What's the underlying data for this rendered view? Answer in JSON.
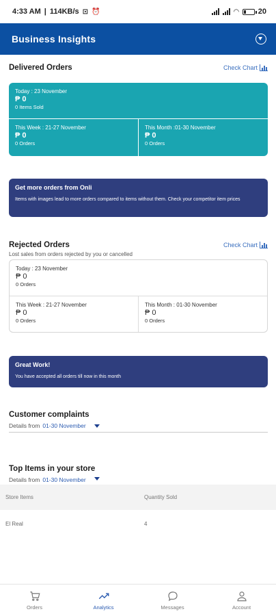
{
  "status_bar": {
    "time": "4:33 AM",
    "speed": "114KB/s",
    "battery": "20"
  },
  "app_bar": {
    "title": "Business Insights",
    "filter_icon": "filter-icon"
  },
  "delivered": {
    "title": "Delivered Orders",
    "check_chart": "Check Chart",
    "today": {
      "label": "Today : 23 November",
      "value": "₱ 0",
      "sub": "0 Items Sold"
    },
    "week": {
      "label": "This Week : 21-27 November",
      "value": "₱ 0",
      "sub": "0 Orders"
    },
    "month": {
      "label": "This Month :01-30 November",
      "value": "₱ 0",
      "sub": "0 Orders"
    }
  },
  "promo": {
    "title": "Get more orders from Onli",
    "body": "Items with images lead to more orders compared to items without them. Check your competitor item prices"
  },
  "rejected": {
    "title": "Rejected Orders",
    "check_chart": "Check Chart",
    "subtitle": "Lost sales from orders rejected by you or cancelled",
    "today": {
      "label": "Today : 23 November",
      "value": "₱ 0",
      "sub": "0 Orders"
    },
    "week": {
      "label": "This Week : 21-27 November",
      "value": "₱ 0",
      "sub": "0 Orders"
    },
    "month": {
      "label": "This Month : 01-30 November",
      "value": "₱ 0",
      "sub": "0 Orders"
    }
  },
  "great_work": {
    "title": "Great Work!",
    "body": "You have accepted all orders till now in this month"
  },
  "complaints": {
    "title": "Customer complaints",
    "details_prefix": "Details from",
    "range": "01-30 November"
  },
  "top_items": {
    "title": "Top Items in your store",
    "details_prefix": "Details from",
    "range": "01-30 November",
    "columns": [
      "Store Items",
      "Quantity Sold"
    ],
    "rows": [
      {
        "item": "El Real",
        "qty": "4"
      }
    ]
  },
  "bottom_nav": {
    "items": [
      {
        "label": "Orders",
        "icon": "cart-icon"
      },
      {
        "label": "Analytics",
        "icon": "analytics-icon"
      },
      {
        "label": "Messages",
        "icon": "chat-icon"
      },
      {
        "label": "Account",
        "icon": "person-icon"
      }
    ],
    "active": "Analytics"
  },
  "colors": {
    "app_bar": "#0c50a2",
    "teal_card": "#1aa5b1",
    "navy_card": "#2f3e7e",
    "accent": "#2b5bb0"
  }
}
